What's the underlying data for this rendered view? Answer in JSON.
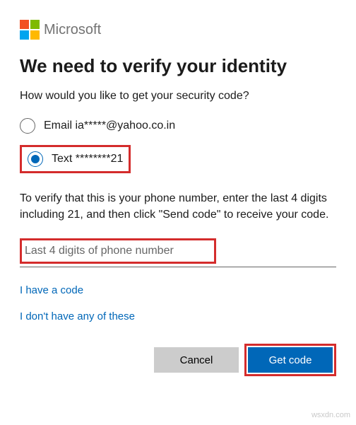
{
  "brand": {
    "name": "Microsoft"
  },
  "heading": "We need to verify your identity",
  "subtitle": "How would you like to get your security code?",
  "options": {
    "email": {
      "label": "Email ia*****@yahoo.co.in",
      "selected": false
    },
    "text": {
      "label": "Text ********21",
      "selected": true
    }
  },
  "verify_text": "To verify that this is your phone number, enter the last 4 digits including 21, and then click \"Send code\" to receive your code.",
  "input": {
    "placeholder": "Last 4 digits of phone number"
  },
  "links": {
    "have_code": "I have a code",
    "none": "I don't have any of these"
  },
  "buttons": {
    "cancel": "Cancel",
    "primary": "Get code"
  },
  "watermark": "wsxdn.com"
}
